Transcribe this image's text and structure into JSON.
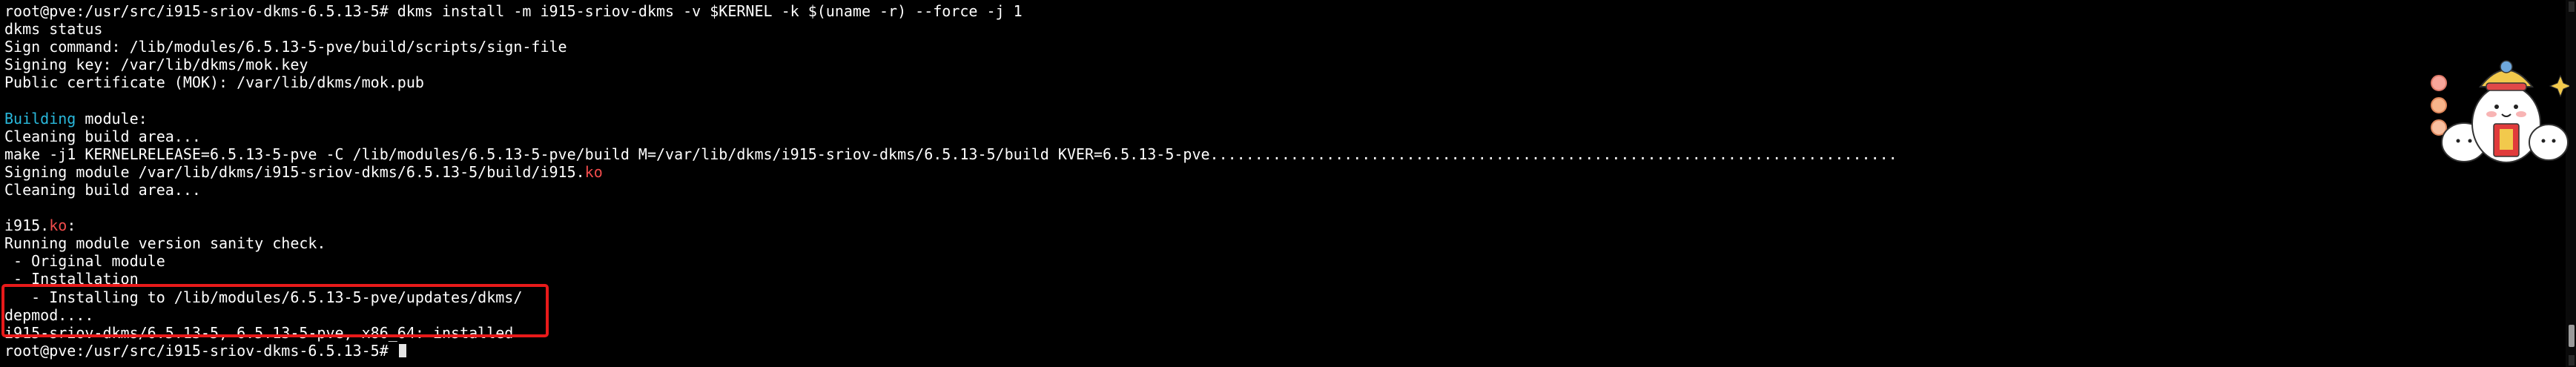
{
  "terminal": {
    "lines": [
      [
        {
          "t": "root@pve:/usr/src/i915-sriov-dkms-6.5.13-5# dkms install -m i915-sriov-dkms -v $KERNEL -k $(uname -r) --force -j 1",
          "c": "normal"
        }
      ],
      [
        {
          "t": "dkms status",
          "c": "normal"
        }
      ],
      [
        {
          "t": "Sign command: /lib/modules/6.5.13-5-pve/build/scripts/sign-file",
          "c": "normal"
        }
      ],
      [
        {
          "t": "Signing key: /var/lib/dkms/mok.key",
          "c": "normal"
        }
      ],
      [
        {
          "t": "Public certificate (MOK): /var/lib/dkms/mok.pub",
          "c": "normal"
        }
      ],
      [],
      [
        {
          "t": "Building",
          "c": "accent"
        },
        {
          "t": " module:",
          "c": "normal"
        }
      ],
      [
        {
          "t": "Cleaning build area...",
          "c": "normal"
        }
      ],
      [
        {
          "t": "make -j1 KERNELRELEASE=6.5.13-5-pve -C /lib/modules/6.5.13-5-pve/build M=/var/lib/dkms/i915-sriov-dkms/6.5.13-5/build KVER=6.5.13-5-pve.............................................................................",
          "c": "normal"
        }
      ],
      [
        {
          "t": "Signing module /var/lib/dkms/i915-sriov-dkms/6.5.13-5/build/i915.",
          "c": "normal"
        },
        {
          "t": "ko",
          "c": "red"
        }
      ],
      [
        {
          "t": "Cleaning build area...",
          "c": "normal"
        }
      ],
      [],
      [
        {
          "t": "i915.",
          "c": "normal"
        },
        {
          "t": "ko",
          "c": "red"
        },
        {
          "t": ":",
          "c": "normal"
        }
      ],
      [
        {
          "t": "Running module version sanity check.",
          "c": "normal"
        }
      ],
      [
        {
          "t": " - Original module",
          "c": "normal"
        }
      ],
      [
        {
          "t": " - Installation",
          "c": "normal"
        }
      ],
      [
        {
          "t": "   - Installing to /lib/modules/6.5.13-5-pve/updates/dkms/",
          "c": "normal"
        }
      ],
      [
        {
          "t": "depmod....",
          "c": "normal"
        }
      ],
      [
        {
          "t": "i915-sriov-dkms/6.5.13-5, 6.5.13-5-pve, x86_64: installed",
          "c": "normal"
        }
      ],
      [
        {
          "t": "root@pve:/usr/src/i915-sriov-dkms-6.5.13-5# ",
          "c": "normal"
        }
      ]
    ],
    "cursor_line": 19
  },
  "colors": {
    "background": "#000000",
    "text": "#ffffff",
    "accent": "#29b8db",
    "extension_red": "#f14c4c",
    "highlight_border": "#e81a1a"
  },
  "decorations": {
    "sticker": "cartoon-mascot-sticker"
  }
}
